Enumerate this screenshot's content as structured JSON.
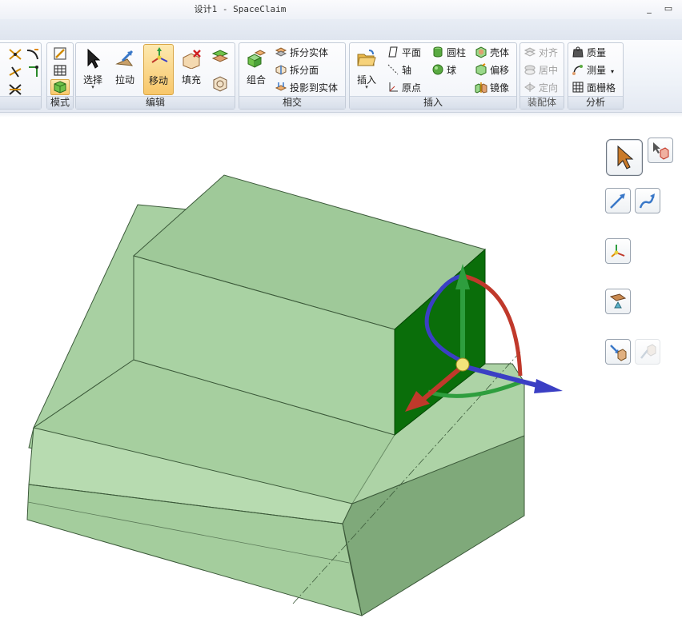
{
  "window": {
    "title": "设计1 - SpaceClaim",
    "minimize": "_",
    "maximize": "▭"
  },
  "ribbon": {
    "mode": {
      "label": "模式"
    },
    "edit": {
      "label": "编辑",
      "select": "选择",
      "pull": "拉动",
      "move": "移动",
      "fill": "填充"
    },
    "intersect": {
      "label": "相交",
      "combine": "组合",
      "split_body": "拆分实体",
      "split_face": "拆分面",
      "project": "投影到实体"
    },
    "insert": {
      "label": "插入",
      "insert": "插入",
      "plane": "平面",
      "axis": "轴",
      "origin": "原点",
      "cylinder": "圆柱",
      "sphere": "球",
      "shell": "壳体",
      "offset": "偏移",
      "mirror": "镜像"
    },
    "assembly": {
      "label": "装配体",
      "align": "对齐",
      "center": "居中",
      "orient": "定向"
    },
    "analysis": {
      "label": "分析",
      "mass": "质量",
      "measure": "测量",
      "mesh": "面栅格"
    }
  },
  "colors": {
    "accent": "#f8c76a",
    "body_green": "#a6cfa0",
    "selected_face": "#0a6e0a",
    "axis_x": "#c0392b",
    "axis_y": "#2e9e3e",
    "axis_z": "#3b3fc4"
  },
  "viewport_tools": [
    "select-tool-icon",
    "select-component-icon",
    "move-along-line-icon",
    "move-along-path-icon",
    "anchor-icon",
    "ruler-dimension-icon",
    "up-to-icon",
    "pivot-icon"
  ]
}
